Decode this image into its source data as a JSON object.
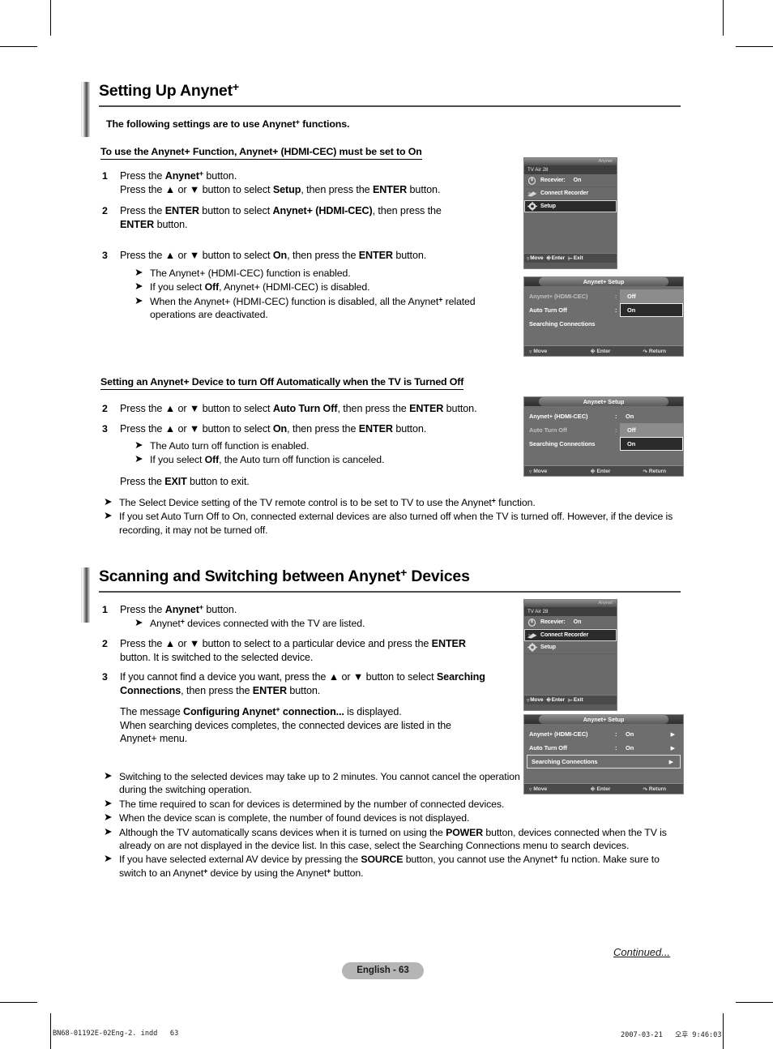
{
  "document": {
    "page_label": "English - 63",
    "continued_label": "Continued...",
    "print_file": "BN68-01192E-02Eng-2. indd",
    "print_page": "63",
    "print_date": "2007-03-21",
    "print_time_prefix": "오후",
    "print_time": "9:46:03"
  },
  "section1": {
    "heading_pre": "Setting Up Anynet",
    "heading_sup": "+",
    "subtitle_pre": "The following settings are to use Anynet",
    "subtitle_sup": "+",
    "subtitle_post": " functions.",
    "underlined_head": "To use the Anynet+ Function, Anynet+ (HDMI-CEC) must be set to On",
    "steps": [
      {
        "num": "1",
        "lines": [
          "Press the <b>Anynet<sup class=\"plus\">+</sup></b> button.",
          "Press the ▲ or ▼ button to select <b>Setup</b>, then press the <b>ENTER</b> button."
        ]
      },
      {
        "num": "2",
        "lines": [
          "Press the <b>ENTER</b> button to select <b>Anynet+ (HDMI-CEC)</b>, then press the",
          "<b>ENTER</b> button."
        ]
      },
      {
        "num": "3",
        "lines": [
          "Press the ▲ or ▼ button to select <b>On</b>, then press the <b>ENTER</b> button."
        ]
      }
    ],
    "bullets": [
      "The Anynet+ (HDMI-CEC) function is enabled.",
      "If you select <b>Off</b>, Anynet+ (HDMI-CEC) is disabled.",
      "When the Anynet+ (HDMI-CEC) function is disabled, all the Anynet<sup class=\"plus\">+</sup> related operations are deactivated."
    ]
  },
  "section1b": {
    "underlined_head": "Setting an Anynet+ Device to turn Off Automatically when the TV is Turned Off",
    "steps": [
      {
        "num": "2",
        "lines": [
          "Press the ▲ or ▼ button to select <b>Auto Turn Off</b>, then press the <b>ENTER</b> button."
        ]
      },
      {
        "num": "3",
        "lines": [
          "Press the ▲ or ▼ button to select <b>On</b>, then press the <b>ENTER</b> button."
        ]
      }
    ],
    "sub_bullets": [
      "The Auto turn off function is enabled.",
      "If you select <b>Off</b>, the Auto turn off function is canceled."
    ],
    "exit_line": "Press the <b>EXIT</b> button to exit.",
    "notes": [
      "The Select Device setting of the TV remote control is to be set to TV to use the Anynet<sup class=\"plus\">+</sup> function.",
      "If you set Auto Turn Off to On, connected external devices are also turned off when the TV is turned off. However, if the device is recording, it may not be turned off."
    ]
  },
  "section2": {
    "heading_pre": "Scanning and Switching between Anynet",
    "heading_sup": "+",
    "heading_post": " Devices",
    "steps": [
      {
        "num": "1",
        "lines": [
          "Press the <b>Anynet<sup class=\"plus\">+</sup></b> button."
        ]
      },
      {
        "num": "2",
        "lines": [
          "Press the ▲ or ▼ button to select to a particular device and press the <b>ENTER</b>",
          "button. It is switched to the selected device."
        ]
      },
      {
        "num": "3",
        "lines": [
          "If you cannot find a device you want, press the ▲ or ▼ button to select <b>Searching</b>",
          "<b>Connections</b>, then press the <b>ENTER</b> button."
        ]
      }
    ],
    "step1_bullet": "Anynet<sup class=\"plus\">+</sup> devices connected with the TV are listed.",
    "message_lines": [
      "The message <b>Configuring Anynet<sup class=\"plus\">+</sup> connection...</b> is displayed.",
      "When searching devices completes, the connected devices are listed in the",
      "Anynet+ menu."
    ],
    "notes": [
      "Switching to the selected devices may take up to 2 minutes. You cannot cancel the operation during the switching operation.",
      "The time required to scan for devices is determined by the number of connected devices.",
      "When the device scan is complete, the number of found devices is not displayed.",
      "Although the TV automatically scans devices when it is turned on using the <b>POWER</b> button, devices connected when the TV is already on are not displayed in the device list. In this case, select the Searching Connections menu to search devices.",
      "If you have selected external AV device by pressing the <b>SOURCE</b> button, you cannot use the Anynet<sup class=\"plus\">+</sup> fu nction. Make sure to switch to an Anynet<sup class=\"plus\">+</sup> device by using the Anynet<sup class=\"plus\">+</sup> button."
    ]
  },
  "osd_device_menu_1": {
    "brand": "Anynet",
    "channel": "TV Air 28",
    "rows": [
      {
        "icon": "receiver-icon",
        "label": "Recevier:",
        "value": "On",
        "selected": false
      },
      {
        "icon": "recorder-icon",
        "label": "Connect Recorder",
        "value": "",
        "selected": false
      },
      {
        "icon": "setup-gear-icon",
        "label": "Setup",
        "value": "",
        "selected": true
      }
    ],
    "footer": [
      {
        "icon": "updown-icon",
        "label": "Move"
      },
      {
        "icon": "enter-icon",
        "label": "Enter"
      },
      {
        "icon": "exit-icon",
        "label": "Exit"
      }
    ]
  },
  "osd_setup_menu_1": {
    "title": "Anynet+ Setup",
    "rows": [
      {
        "label": "Anynet+ (HDMI-CEC)",
        "colon": ":",
        "value": "",
        "dim": true
      },
      {
        "label": "Auto Turn Off",
        "colon": ":",
        "value": "",
        "dim": false
      },
      {
        "label": "Searching Connections",
        "colon": "",
        "value": "",
        "dim": false
      }
    ],
    "dropdown": {
      "options": [
        "Off",
        "On"
      ],
      "active_index": 1
    },
    "footer": [
      {
        "icon": "updown-icon",
        "label": "Move"
      },
      {
        "icon": "enter-icon",
        "label": "Enter"
      },
      {
        "icon": "return-icon",
        "label": "Return"
      }
    ]
  },
  "osd_setup_menu_2": {
    "title": "Anynet+ Setup",
    "rows": [
      {
        "label": "Anynet+ (HDMI-CEC)",
        "colon": ":",
        "value": "On",
        "dim": false
      },
      {
        "label": "Auto Turn Off",
        "colon": ":",
        "value": "",
        "dim": true
      },
      {
        "label": "Searching Connections",
        "colon": "",
        "value": "",
        "dim": false
      }
    ],
    "dropdown": {
      "options": [
        "Off",
        "On"
      ],
      "active_index": 1
    },
    "footer": [
      {
        "icon": "updown-icon",
        "label": "Move"
      },
      {
        "icon": "enter-icon",
        "label": "Enter"
      },
      {
        "icon": "return-icon",
        "label": "Return"
      }
    ]
  },
  "osd_device_menu_2": {
    "brand": "Anynet",
    "channel": "TV Air 28",
    "rows": [
      {
        "icon": "receiver-icon",
        "label": "Recevier:",
        "value": "On",
        "selected": false
      },
      {
        "icon": "recorder-icon",
        "label": "Connect Recorder",
        "value": "",
        "selected": true
      },
      {
        "icon": "setup-gear-icon",
        "label": "Setup",
        "value": "",
        "selected": false
      }
    ],
    "footer": [
      {
        "icon": "updown-icon",
        "label": "Move"
      },
      {
        "icon": "enter-icon",
        "label": "Enter"
      },
      {
        "icon": "exit-icon",
        "label": "Exit"
      }
    ]
  },
  "osd_setup_menu_3": {
    "title": "Anynet+ Setup",
    "rows": [
      {
        "label": "Anynet+ (HDMI-CEC)",
        "colon": ":",
        "value": "On",
        "arrow": "▶",
        "dim": false,
        "selected": false
      },
      {
        "label": "Auto Turn Off",
        "colon": ":",
        "value": "On",
        "arrow": "▶",
        "dim": false,
        "selected": false
      },
      {
        "label": "Searching Connections",
        "colon": "",
        "value": "",
        "arrow": "▶",
        "dim": false,
        "selected": true
      }
    ],
    "footer": [
      {
        "icon": "updown-icon",
        "label": "Move"
      },
      {
        "icon": "enter-icon",
        "label": "Enter"
      },
      {
        "icon": "return-icon",
        "label": "Return"
      }
    ]
  },
  "colors": {
    "osd_bg": "#6e6e6e",
    "osd_selected": "#2b2b2b",
    "page_pill": "#b5b5b5",
    "rule": "#4d4d4d"
  }
}
